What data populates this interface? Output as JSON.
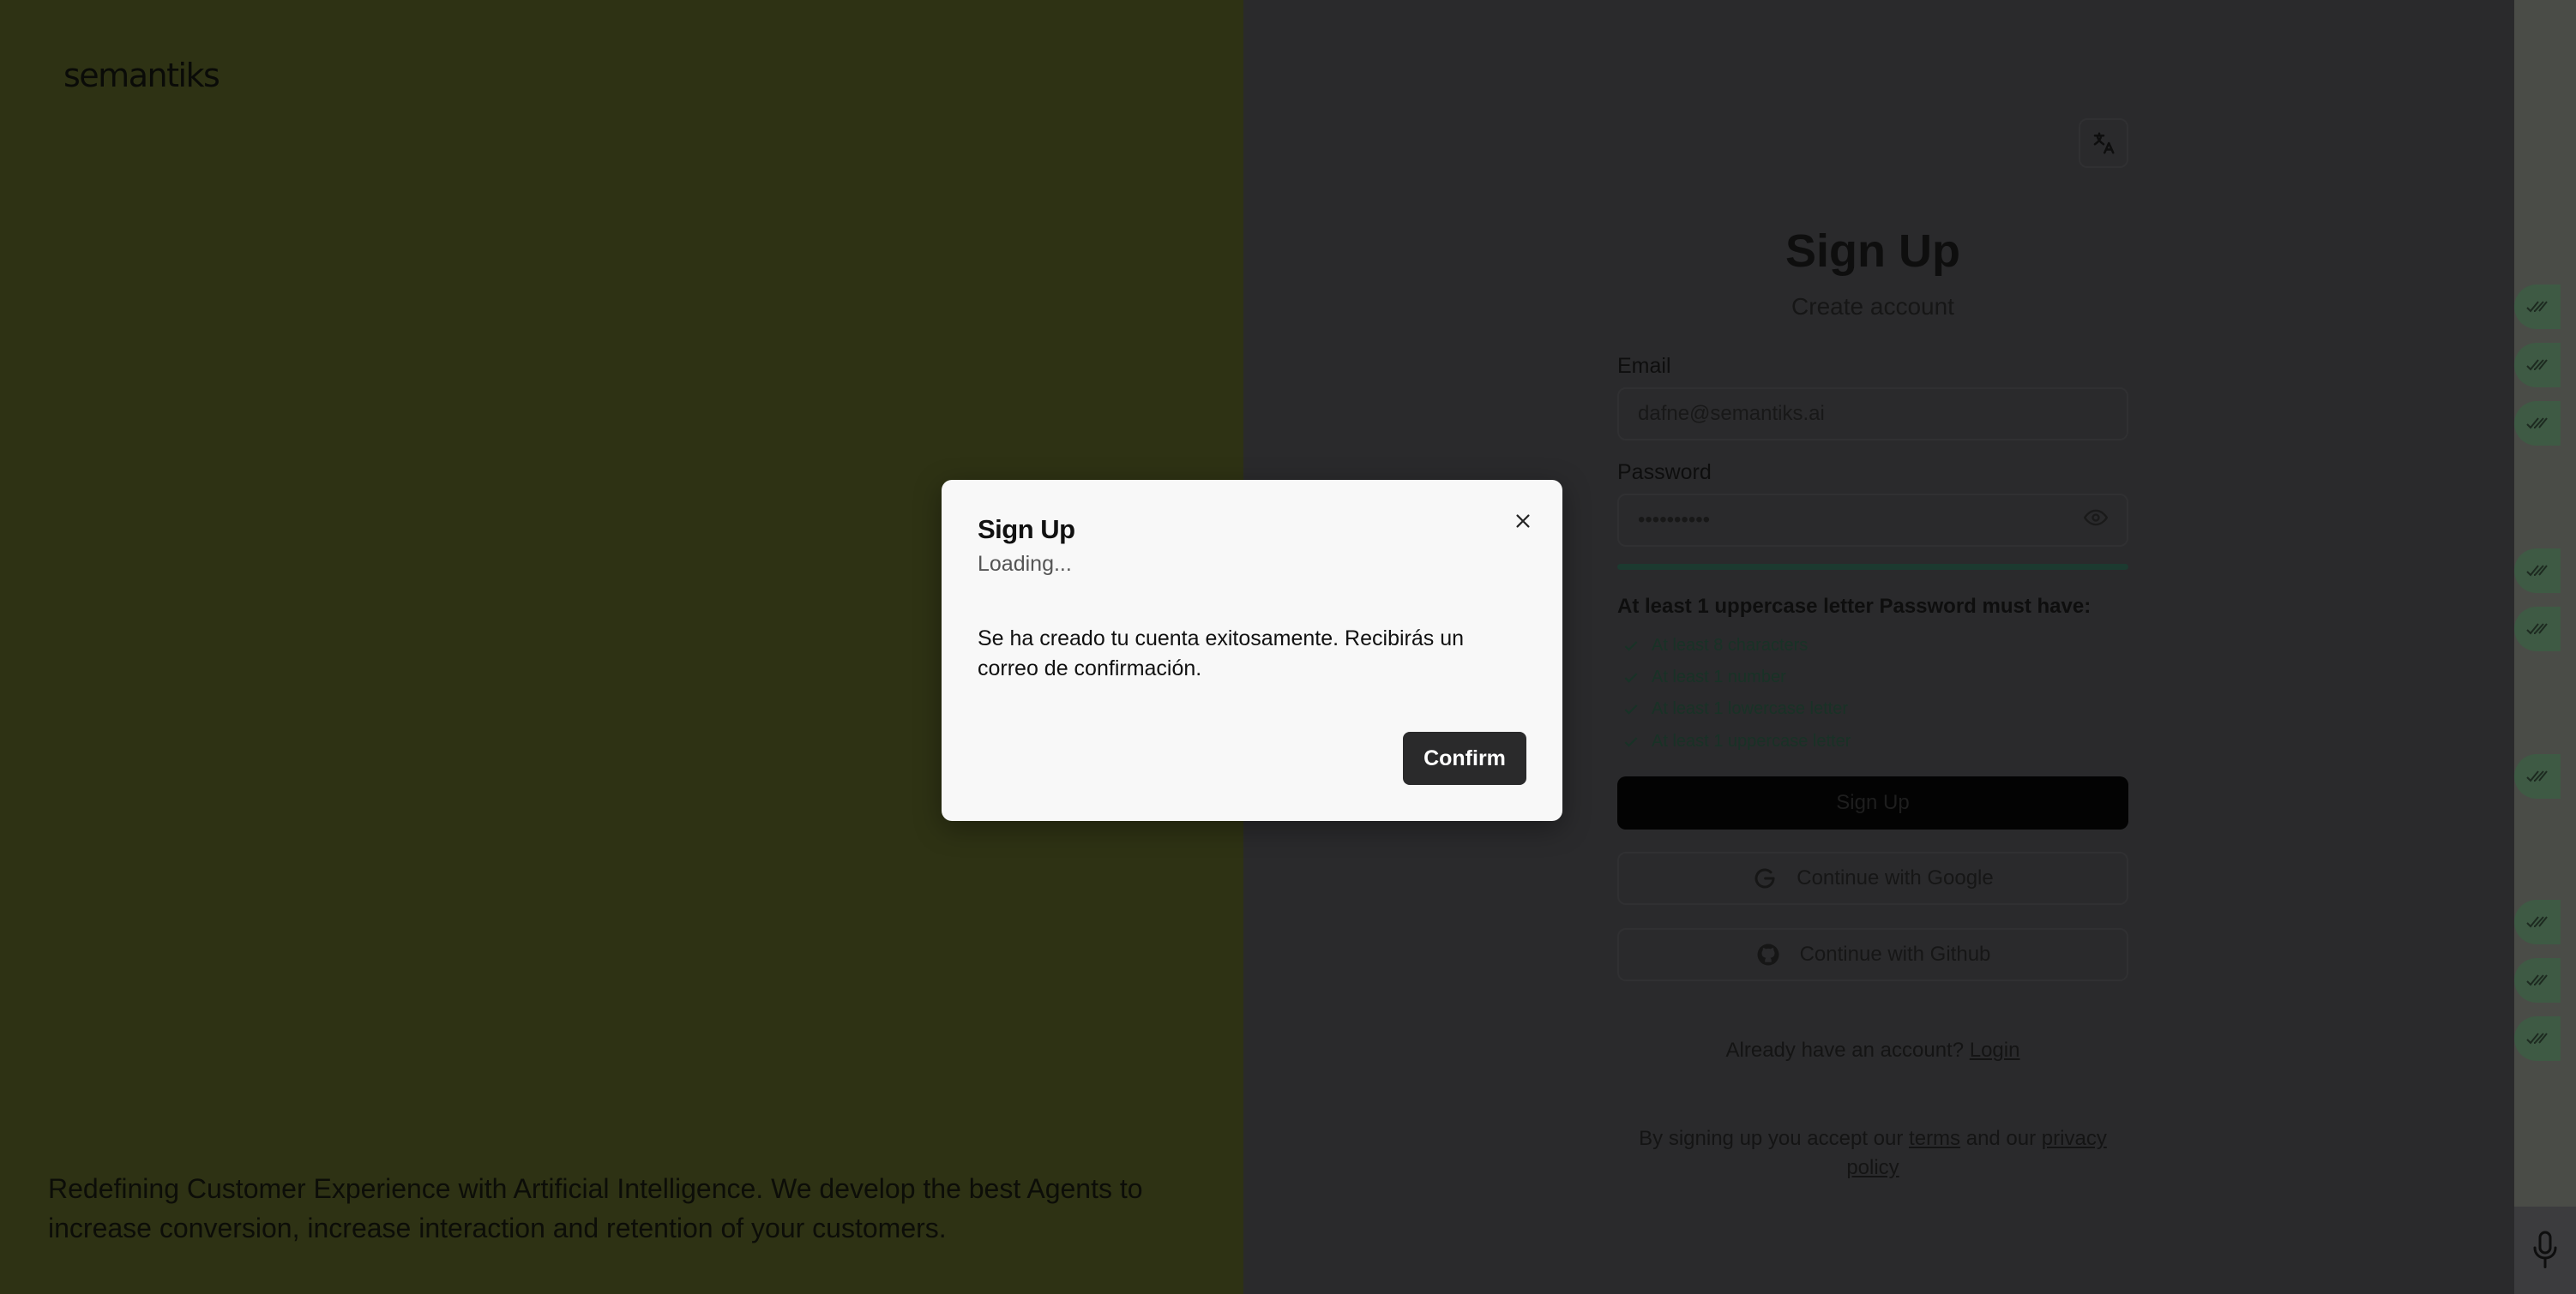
{
  "brand": {
    "logo": "semantiks",
    "tagline": "Redefining Customer Experience with Artificial Intelligence. We develop the best Agents to increase conversion, increase interaction and retention of your customers."
  },
  "form": {
    "title": "Sign Up",
    "subtitle": "Create account",
    "email_label": "Email",
    "email_value": "dafne@semantiks.ai",
    "password_label": "Password",
    "password_value": "••••••••••",
    "password_strength": 1.0,
    "requirements_title": "At least 1 uppercase letter Password must have:",
    "requirements": [
      "At least 8 characters",
      "At least 1 number",
      "At least 1 lowercase letter",
      "At least 1 uppercase letter"
    ],
    "submit_label": "Sign Up",
    "google_label": "Continue with Google",
    "github_label": "Continue with Github",
    "already_text": "Already have an account?",
    "login_link": "Login",
    "terms_prefix": "By signing up you accept our",
    "terms_link": "terms",
    "terms_and": "and our",
    "privacy_link": "privacy policy"
  },
  "modal": {
    "title": "Sign Up",
    "subtitle": "Loading...",
    "body": "Se ha creado tu cuenta exitosamente. Recibirás un correo de confirmación.",
    "confirm_label": "Confirm"
  },
  "icons": {
    "language": "translate-icon",
    "eye": "eye-icon",
    "check": "check-icon",
    "google": "google-icon",
    "github": "github-icon",
    "close": "close-icon",
    "mic": "microphone-icon",
    "read_receipt": "double-check-icon"
  },
  "colors": {
    "left_panel": "#2e3214",
    "overlay_panel": "#2a2a2c",
    "modal_bg": "#f8f8f8",
    "confirm_btn": "#2a2a2b",
    "strength_bar": "#1c3a30"
  }
}
